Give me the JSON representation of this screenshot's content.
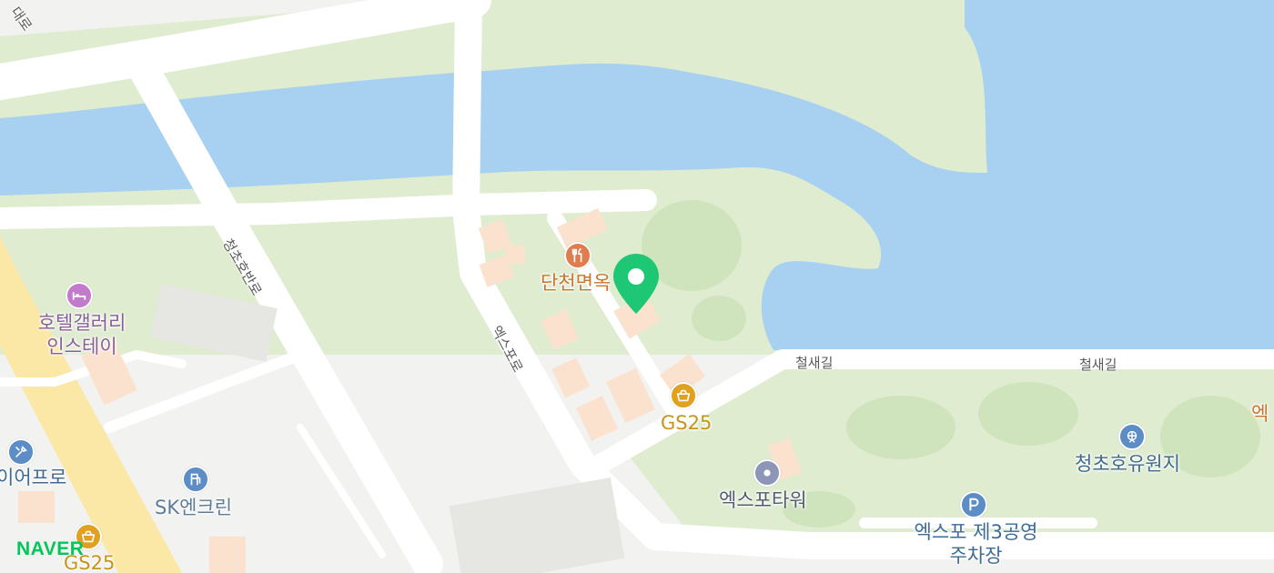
{
  "colors": {
    "water": "#a8d1f1",
    "park": "#dfecd0",
    "park_dark": "#cfe4bd",
    "road": "#ffffff",
    "ground": "#f2f2f0",
    "building": "#fbe2cf",
    "highway": "#fbe8a6",
    "restaurant": "#e07d4e",
    "store": "#e0a020",
    "marker": "#1ec774",
    "brand": "#03c75a"
  },
  "roads": [
    {
      "name": "청초호반로"
    },
    {
      "name": "엑스포로"
    },
    {
      "name": "철새길"
    },
    {
      "name": "철새길"
    },
    {
      "name": "대로"
    }
  ],
  "pois": [
    {
      "name": "단천면옥",
      "icon": "restaurant-icon",
      "color": "#c8752d"
    },
    {
      "name": "GS25",
      "icon": "convenience-store-icon",
      "color": "#c8941a"
    },
    {
      "name": "호텔갤러리 인스테이",
      "icon": "hotel-icon",
      "color": "#8a5f96"
    },
    {
      "name": "SK엔크린",
      "icon": "gas-station-icon",
      "color": "#5d7c9a"
    },
    {
      "name": "엑스포타워",
      "icon": "tower-icon",
      "color": "#555b6e"
    },
    {
      "name": "청초호유원지",
      "icon": "ferris-wheel-icon",
      "color": "#3f6a8a"
    },
    {
      "name": "엑스포 제3공영주차장",
      "icon": "parking-icon",
      "color": "#3e6b96"
    },
    {
      "name": "이어프로",
      "icon": "repair-icon",
      "color": "#3e6b96"
    },
    {
      "name": "GS25",
      "icon": "convenience-store-icon",
      "color": "#c8941a"
    },
    {
      "name": "엑",
      "icon": "",
      "color": "#c8752d"
    }
  ],
  "brand": "NAVER"
}
